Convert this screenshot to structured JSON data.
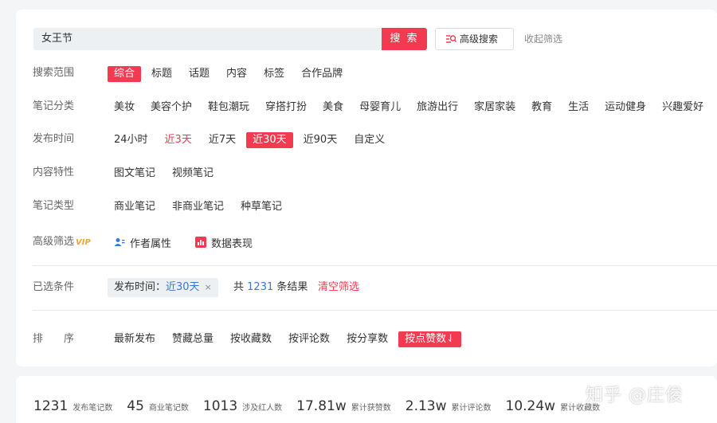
{
  "search": {
    "query": "女王节",
    "search_label": "搜 索",
    "advanced_label": "高级搜索",
    "collapse_label": "收起筛选"
  },
  "filters": {
    "scope": {
      "label": "搜索范围",
      "options": [
        "综合",
        "标题",
        "话题",
        "内容",
        "标签",
        "合作品牌"
      ],
      "active": 0
    },
    "category": {
      "label": "笔记分类",
      "options": [
        "美妆",
        "美容个护",
        "鞋包潮玩",
        "穿搭打扮",
        "美食",
        "母婴育儿",
        "旅游出行",
        "家居家装",
        "教育",
        "生活",
        "运动健身",
        "兴趣爱好"
      ]
    },
    "time": {
      "label": "发布时间",
      "options": [
        "24小时",
        "近3天",
        "近7天",
        "近30天",
        "近90天",
        "自定义"
      ],
      "active": 3,
      "hot": 1
    },
    "content": {
      "label": "内容特性",
      "options": [
        "图文笔记",
        "视频笔记"
      ]
    },
    "type": {
      "label": "笔记类型",
      "options": [
        "商业笔记",
        "非商业笔记",
        "种草笔记"
      ]
    },
    "advanced": {
      "label": "高级筛选",
      "vip": "VIP",
      "author_label": "作者属性",
      "data_label": "数据表现"
    }
  },
  "selected": {
    "label": "已选条件",
    "chip_key": "发布时间：",
    "chip_value": "近30天",
    "chip_close": "×",
    "count_prefix": "共",
    "count_value": "1231",
    "count_suffix": "条结果",
    "clear_label": "清空筛选"
  },
  "sort": {
    "label_a": "排",
    "label_b": "序",
    "options": [
      "最新发布",
      "赞藏总量",
      "按收藏数",
      "按评论数",
      "按分享数",
      "按点赞数"
    ],
    "active": 5,
    "active_suffix": "⇃"
  },
  "stats": [
    {
      "value": "1231",
      "label": "发布笔记数"
    },
    {
      "value": "45",
      "label": "商业笔记数"
    },
    {
      "value": "1013",
      "label": "涉及红人数"
    },
    {
      "value": "17.81w",
      "label": "累计获赞数"
    },
    {
      "value": "2.13w",
      "label": "累计评论数"
    },
    {
      "value": "10.24w",
      "label": "累计收藏数"
    }
  ],
  "watermark": "知乎 @庄俊",
  "colors": {
    "accent": "#f23a50",
    "link": "#3a78d6",
    "vip": "#e8a83a"
  }
}
